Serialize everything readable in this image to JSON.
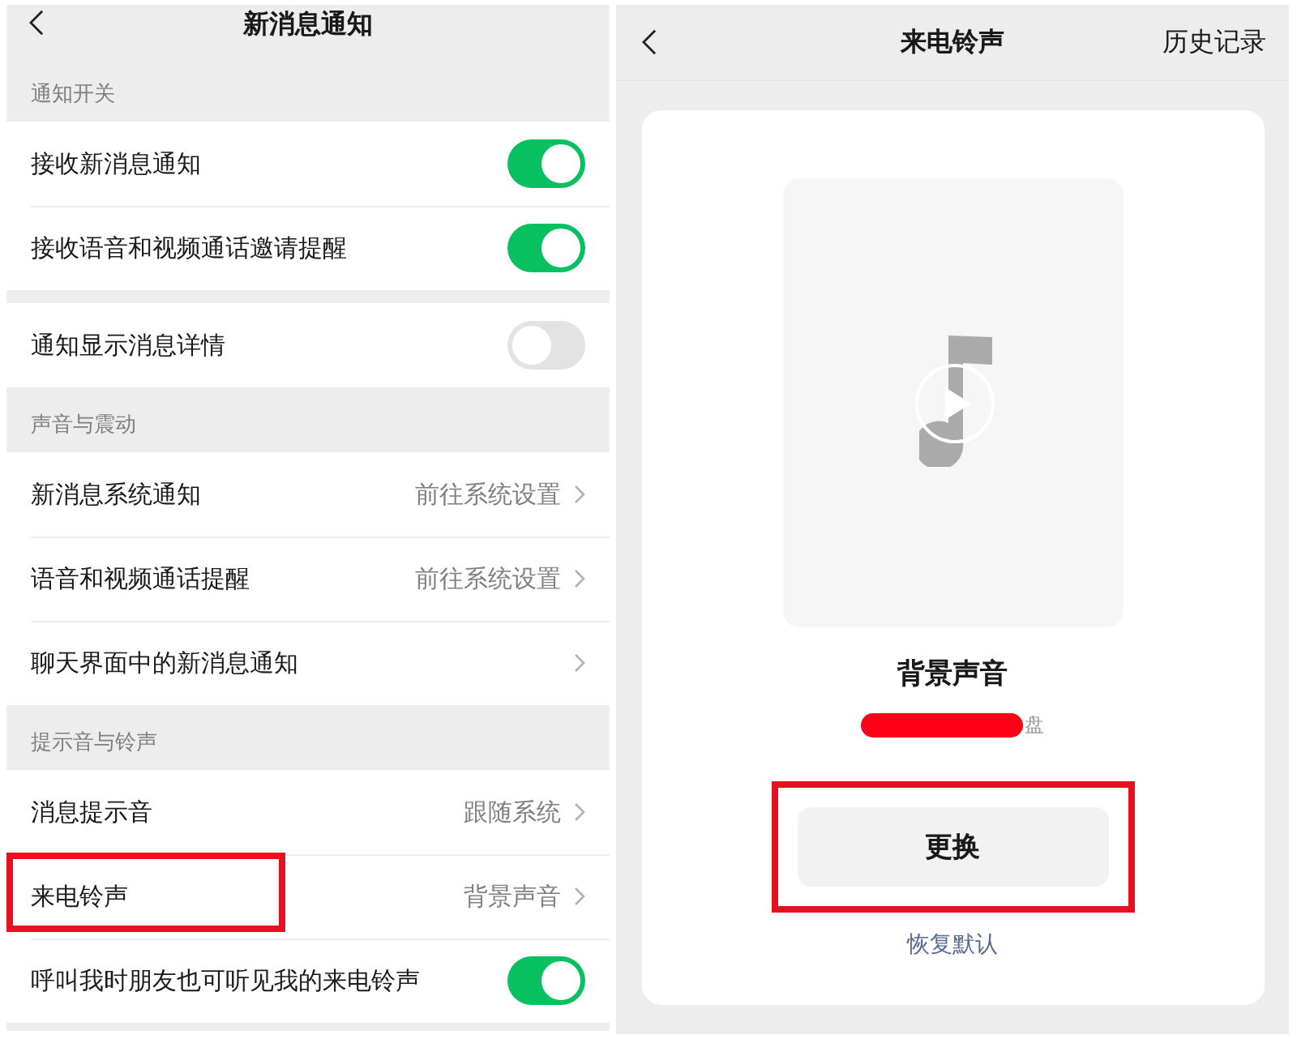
{
  "left_screen": {
    "title": "新消息通知",
    "groups": [
      {
        "title": "通知开关",
        "items": [
          {
            "kind": "toggle",
            "label": "接收新消息通知",
            "on": true,
            "highlighted": false
          },
          {
            "kind": "toggle",
            "label": "接收语音和视频通话邀请提醒",
            "on": true,
            "highlighted": false
          }
        ]
      },
      {
        "items": [
          {
            "kind": "toggle",
            "label": "通知显示消息详情",
            "on": false,
            "highlighted": false
          }
        ]
      },
      {
        "title": "声音与震动",
        "items": [
          {
            "kind": "link",
            "label": "新消息系统通知",
            "value": "前往系统设置",
            "highlighted": false
          },
          {
            "kind": "link",
            "label": "语音和视频通话提醒",
            "value": "前往系统设置",
            "highlighted": false
          },
          {
            "kind": "link",
            "label": "聊天界面中的新消息通知",
            "highlighted": false
          }
        ]
      },
      {
        "title": "提示音与铃声",
        "items": [
          {
            "kind": "link",
            "label": "消息提示音",
            "value": "跟随系统",
            "highlighted": false
          },
          {
            "kind": "link",
            "label": "来电铃声",
            "value": "背景声音",
            "highlighted": true
          },
          {
            "kind": "toggle",
            "label": "呼叫我时朋友也可听见我的来电铃声",
            "on": true,
            "highlighted": false
          }
        ]
      }
    ]
  },
  "right_screen": {
    "title": "来电铃声",
    "action": "历史记录",
    "ringtone": {
      "name": "背景声音",
      "source": "盘",
      "source_redacted": true
    },
    "change_button": {
      "label": "更换",
      "highlighted": true
    },
    "reset_link": "恢复默认"
  }
}
